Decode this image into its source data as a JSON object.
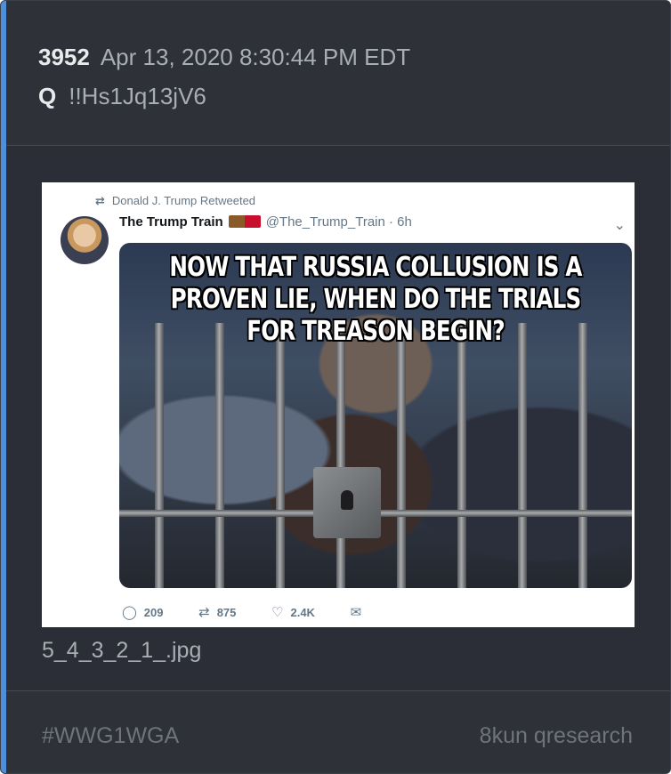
{
  "post": {
    "number": "3952",
    "timestamp": "Apr 13, 2020 8:30:44 PM EDT",
    "author": "Q",
    "tripcode": "!!Hs1Jq13jV6"
  },
  "attachment": {
    "filename": "5_4_3_2_1_.jpg",
    "tweet": {
      "retweeted_by": "Donald J. Trump Retweeted",
      "display_name": "The Trump Train",
      "handle": "@The_Trump_Train · 6h",
      "meme_lines": [
        "NOW THAT RUSSIA COLLUSION IS A",
        "PROVEN LIE, WHEN DO THE TRIALS",
        "FOR TREASON BEGIN?"
      ],
      "replies": "209",
      "retweets": "875",
      "likes": "2.4K"
    }
  },
  "footer": {
    "hashtag": "#WWG1WGA",
    "source": "8kun qresearch"
  },
  "colors": {
    "accent": "#4e8fdc",
    "card_bg": "#2b2e36",
    "text_primary": "#e9eaec",
    "text_secondary": "#a9adb4",
    "text_muted": "#6f737b"
  }
}
